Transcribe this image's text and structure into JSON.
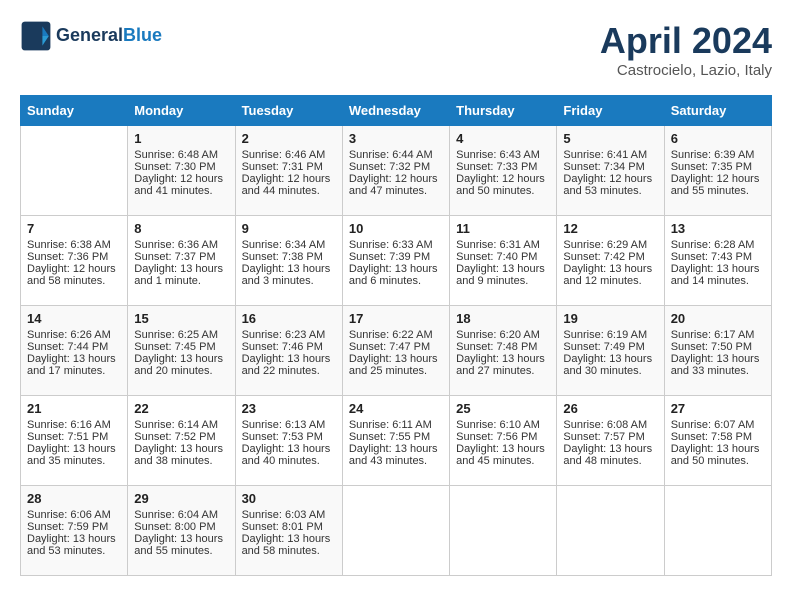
{
  "header": {
    "logo_line1": "General",
    "logo_line2": "Blue",
    "month": "April 2024",
    "location": "Castrocielo, Lazio, Italy"
  },
  "weekdays": [
    "Sunday",
    "Monday",
    "Tuesday",
    "Wednesday",
    "Thursday",
    "Friday",
    "Saturday"
  ],
  "weeks": [
    [
      {
        "day": "",
        "info": ""
      },
      {
        "day": "1",
        "info": "Sunrise: 6:48 AM\nSunset: 7:30 PM\nDaylight: 12 hours\nand 41 minutes."
      },
      {
        "day": "2",
        "info": "Sunrise: 6:46 AM\nSunset: 7:31 PM\nDaylight: 12 hours\nand 44 minutes."
      },
      {
        "day": "3",
        "info": "Sunrise: 6:44 AM\nSunset: 7:32 PM\nDaylight: 12 hours\nand 47 minutes."
      },
      {
        "day": "4",
        "info": "Sunrise: 6:43 AM\nSunset: 7:33 PM\nDaylight: 12 hours\nand 50 minutes."
      },
      {
        "day": "5",
        "info": "Sunrise: 6:41 AM\nSunset: 7:34 PM\nDaylight: 12 hours\nand 53 minutes."
      },
      {
        "day": "6",
        "info": "Sunrise: 6:39 AM\nSunset: 7:35 PM\nDaylight: 12 hours\nand 55 minutes."
      }
    ],
    [
      {
        "day": "7",
        "info": "Sunrise: 6:38 AM\nSunset: 7:36 PM\nDaylight: 12 hours\nand 58 minutes."
      },
      {
        "day": "8",
        "info": "Sunrise: 6:36 AM\nSunset: 7:37 PM\nDaylight: 13 hours\nand 1 minute."
      },
      {
        "day": "9",
        "info": "Sunrise: 6:34 AM\nSunset: 7:38 PM\nDaylight: 13 hours\nand 3 minutes."
      },
      {
        "day": "10",
        "info": "Sunrise: 6:33 AM\nSunset: 7:39 PM\nDaylight: 13 hours\nand 6 minutes."
      },
      {
        "day": "11",
        "info": "Sunrise: 6:31 AM\nSunset: 7:40 PM\nDaylight: 13 hours\nand 9 minutes."
      },
      {
        "day": "12",
        "info": "Sunrise: 6:29 AM\nSunset: 7:42 PM\nDaylight: 13 hours\nand 12 minutes."
      },
      {
        "day": "13",
        "info": "Sunrise: 6:28 AM\nSunset: 7:43 PM\nDaylight: 13 hours\nand 14 minutes."
      }
    ],
    [
      {
        "day": "14",
        "info": "Sunrise: 6:26 AM\nSunset: 7:44 PM\nDaylight: 13 hours\nand 17 minutes."
      },
      {
        "day": "15",
        "info": "Sunrise: 6:25 AM\nSunset: 7:45 PM\nDaylight: 13 hours\nand 20 minutes."
      },
      {
        "day": "16",
        "info": "Sunrise: 6:23 AM\nSunset: 7:46 PM\nDaylight: 13 hours\nand 22 minutes."
      },
      {
        "day": "17",
        "info": "Sunrise: 6:22 AM\nSunset: 7:47 PM\nDaylight: 13 hours\nand 25 minutes."
      },
      {
        "day": "18",
        "info": "Sunrise: 6:20 AM\nSunset: 7:48 PM\nDaylight: 13 hours\nand 27 minutes."
      },
      {
        "day": "19",
        "info": "Sunrise: 6:19 AM\nSunset: 7:49 PM\nDaylight: 13 hours\nand 30 minutes."
      },
      {
        "day": "20",
        "info": "Sunrise: 6:17 AM\nSunset: 7:50 PM\nDaylight: 13 hours\nand 33 minutes."
      }
    ],
    [
      {
        "day": "21",
        "info": "Sunrise: 6:16 AM\nSunset: 7:51 PM\nDaylight: 13 hours\nand 35 minutes."
      },
      {
        "day": "22",
        "info": "Sunrise: 6:14 AM\nSunset: 7:52 PM\nDaylight: 13 hours\nand 38 minutes."
      },
      {
        "day": "23",
        "info": "Sunrise: 6:13 AM\nSunset: 7:53 PM\nDaylight: 13 hours\nand 40 minutes."
      },
      {
        "day": "24",
        "info": "Sunrise: 6:11 AM\nSunset: 7:55 PM\nDaylight: 13 hours\nand 43 minutes."
      },
      {
        "day": "25",
        "info": "Sunrise: 6:10 AM\nSunset: 7:56 PM\nDaylight: 13 hours\nand 45 minutes."
      },
      {
        "day": "26",
        "info": "Sunrise: 6:08 AM\nSunset: 7:57 PM\nDaylight: 13 hours\nand 48 minutes."
      },
      {
        "day": "27",
        "info": "Sunrise: 6:07 AM\nSunset: 7:58 PM\nDaylight: 13 hours\nand 50 minutes."
      }
    ],
    [
      {
        "day": "28",
        "info": "Sunrise: 6:06 AM\nSunset: 7:59 PM\nDaylight: 13 hours\nand 53 minutes."
      },
      {
        "day": "29",
        "info": "Sunrise: 6:04 AM\nSunset: 8:00 PM\nDaylight: 13 hours\nand 55 minutes."
      },
      {
        "day": "30",
        "info": "Sunrise: 6:03 AM\nSunset: 8:01 PM\nDaylight: 13 hours\nand 58 minutes."
      },
      {
        "day": "",
        "info": ""
      },
      {
        "day": "",
        "info": ""
      },
      {
        "day": "",
        "info": ""
      },
      {
        "day": "",
        "info": ""
      }
    ]
  ]
}
